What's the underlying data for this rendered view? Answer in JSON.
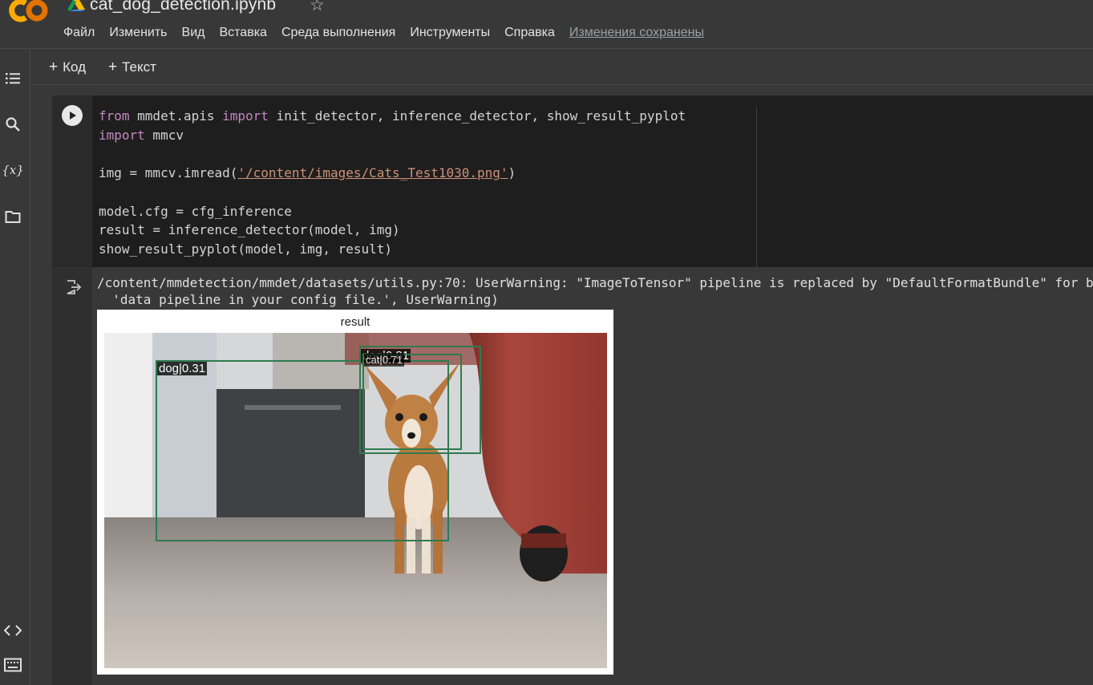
{
  "header": {
    "logo_text": "CO",
    "notebook_title": "cat_dog_detection.ipynb",
    "star_glyph": "☆",
    "menu": [
      "Файл",
      "Изменить",
      "Вид",
      "Вставка",
      "Среда выполнения",
      "Инструменты",
      "Справка"
    ],
    "save_status": "Изменения сохранены"
  },
  "left_rail": {
    "icons": [
      "toc-icon",
      "search-icon",
      "variables-icon",
      "folder-icon",
      "code-snippets-icon",
      "terminal-icon"
    ],
    "variables_glyph": "{x}"
  },
  "toolbar": {
    "add_code_label": "Код",
    "add_text_label": "Текст",
    "plus_glyph": "+"
  },
  "cell": {
    "code_lines": [
      [
        "from",
        " mmdet.apis ",
        "import",
        " init_detector, inference_detector, show_result_pyplot"
      ],
      [
        "import",
        " mmcv"
      ],
      [
        ""
      ],
      [
        "img = mmcv.imread(",
        "'/content/images/Cats_Test1030.png'",
        ")"
      ],
      [
        ""
      ],
      [
        "model.cfg = cfg_inference"
      ],
      [
        "result = inference_detector(model, img)"
      ],
      [
        "show_result_pyplot(model, img, result)"
      ]
    ],
    "code_text": {
      "l1_kw1": "from",
      "l1_a": " mmdet.apis ",
      "l1_kw2": "import",
      "l1_b": " init_detector, inference_detector, show_result_pyplot",
      "l2_kw": "import",
      "l2_a": " mmcv",
      "l4_a": "img = mmcv.imread(",
      "l4_str": "'/content/images/Cats_Test1030.png'",
      "l4_b": ")",
      "l6": "model.cfg = cfg_inference",
      "l7": "result = inference_detector(model, img)",
      "l8": "show_result_pyplot(model, img, result)"
    },
    "output": {
      "warning_line1": "/content/mmdetection/mmdet/datasets/utils.py:70: UserWarning: \"ImageToTensor\" pipeline is replaced by \"DefaultFormatBundle\" for b",
      "warning_line2": "  'data pipeline in your config file.', UserWarning)",
      "plot_title": "result",
      "detections": [
        {
          "label": "dog|0.31"
        },
        {
          "label": "dog|0.81"
        },
        {
          "label": "cat|0.71"
        }
      ]
    }
  },
  "colors": {
    "background": "#383838",
    "code_background": "#1e1e1e",
    "keyword": "#c586c0",
    "string": "#ce9178",
    "bbox": "#2f7a4f",
    "logo_orange": "#f9ab00",
    "logo_dark_orange": "#e37400"
  }
}
